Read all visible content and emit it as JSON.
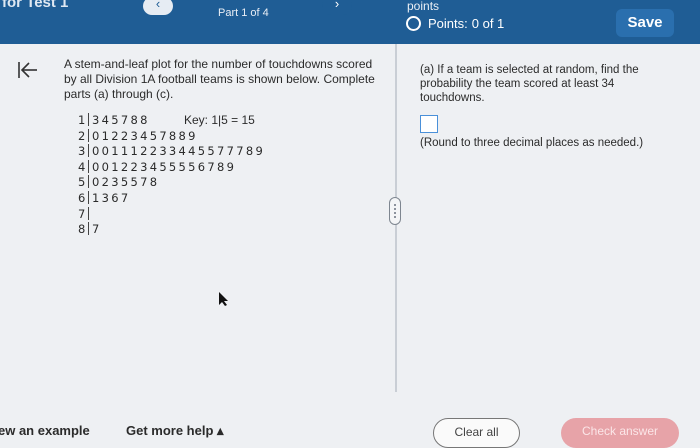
{
  "header": {
    "title": "for Test 1",
    "part_label": "Part 1 of 4",
    "prev_icon": "‹",
    "next_icon": "›",
    "points_caption": "points",
    "points_label": "Points:",
    "points_value": "0 of 1",
    "save_label": "Save"
  },
  "left": {
    "prompt": "A stem-and-leaf plot for the number of touchdowns scored by all Division 1A football teams is shown below. Complete parts (a) through (c).",
    "key": "Key: 1|5 = 15",
    "rows": [
      {
        "stem": "1",
        "leaves": "345788"
      },
      {
        "stem": "2",
        "leaves": "01223457889"
      },
      {
        "stem": "3",
        "leaves": "001112233445577789"
      },
      {
        "stem": "4",
        "leaves": "001223455556789"
      },
      {
        "stem": "5",
        "leaves": "0235578"
      },
      {
        "stem": "6",
        "leaves": "1367"
      },
      {
        "stem": "7",
        "leaves": ""
      },
      {
        "stem": "8",
        "leaves": "7"
      }
    ]
  },
  "right": {
    "question": "(a) If a team is selected at random, find the probability the team scored at least 34 touchdowns.",
    "round_note": "(Round to three decimal places as needed.)"
  },
  "footer": {
    "example_label": "ew an example",
    "help_label": "Get more help ▴",
    "clear_label": "Clear all",
    "check_label": "Check answer"
  },
  "colors": {
    "header_bg": "#1f5d95",
    "save_bg": "#2a6fae",
    "check_bg": "#e7a3a8",
    "answer_box_border": "#4a90d9"
  },
  "icons": [
    "back-to-start-icon",
    "chevron-left-icon",
    "chevron-right-icon",
    "radio-ring-icon",
    "resize-handle-icon",
    "mouse-cursor-icon"
  ]
}
